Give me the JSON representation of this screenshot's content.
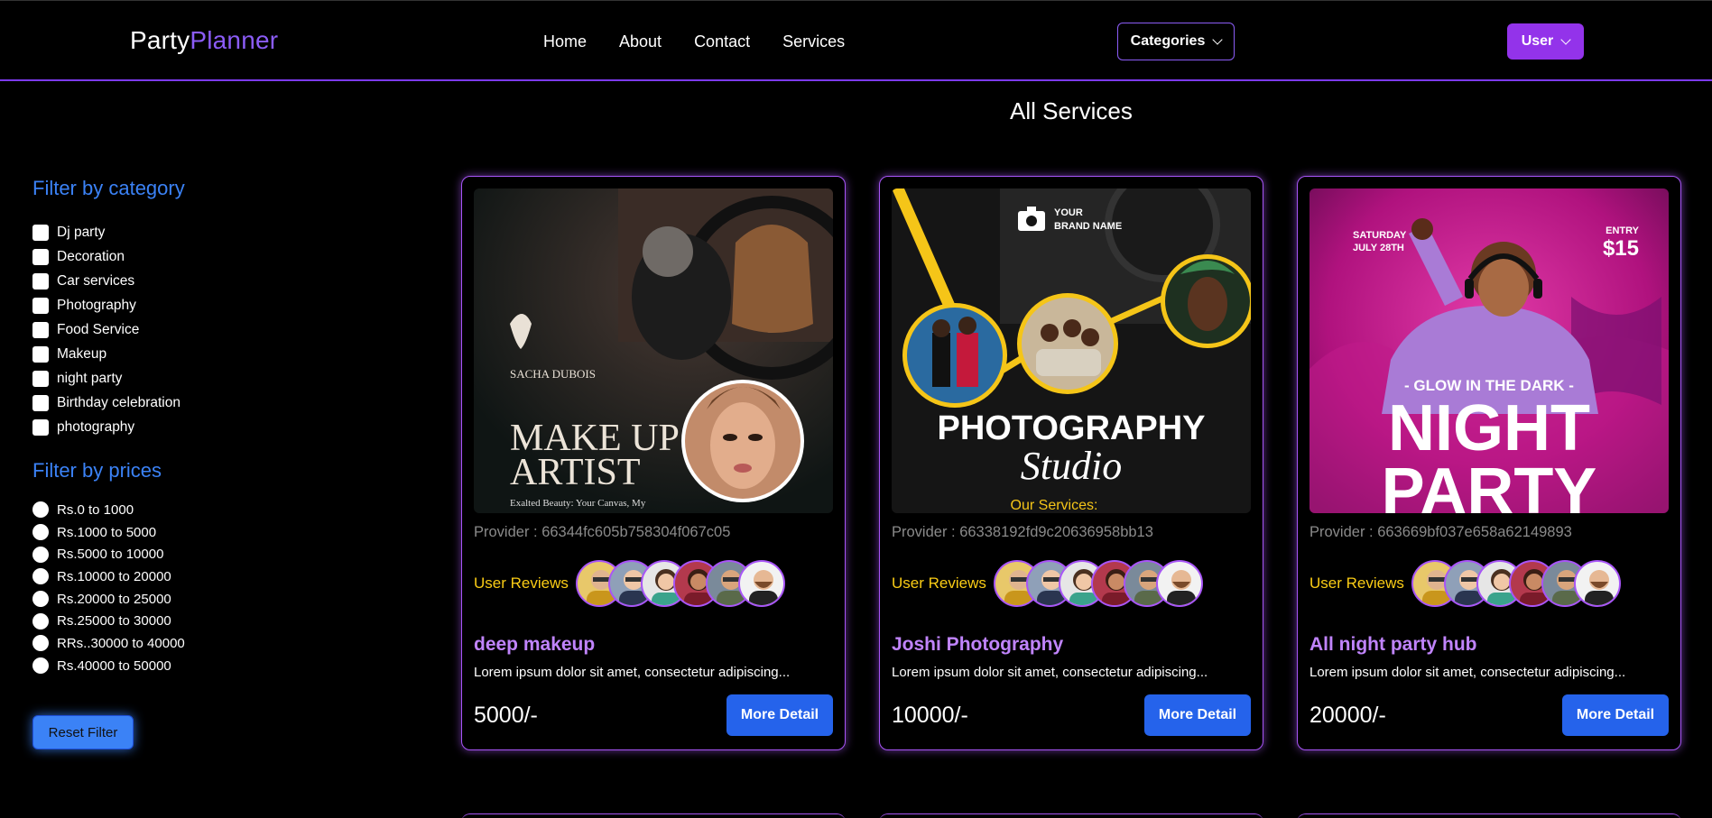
{
  "brand": {
    "part1": "Party",
    "part2": "Planner"
  },
  "nav": {
    "links": [
      "Home",
      "About",
      "Contact",
      "Services"
    ],
    "categories_label": "Categories",
    "user_label": "User"
  },
  "page_title": "All Services",
  "sidebar": {
    "category_heading": "Filter by category",
    "categories": [
      "Dj party",
      "Decoration",
      "Car services",
      "Photography",
      "Food Service",
      "Makeup",
      "night party",
      "Birthday celebration",
      "photography"
    ],
    "price_heading": "Filter by prices",
    "prices": [
      "Rs.0 to 1000",
      "Rs.1000 to 5000",
      "Rs.5000 to 10000",
      "Rs.10000 to 20000",
      "Rs.20000 to 25000",
      "Rs.25000 to 30000",
      "RRs..30000 to 40000",
      "Rs.40000 to 50000"
    ],
    "reset_label": "Reset Filter"
  },
  "cards": [
    {
      "provider": "Provider : 66344fc605b758304f067c05",
      "reviews_label": "User Reviews",
      "title": "deep makeup",
      "description": "Lorem ipsum dolor sit amet, consectetur adipiscing...",
      "price": "5000/-",
      "button": "More Detail",
      "poster": {
        "logo": "SACHA DUBOIS",
        "line1": "MAKE UP",
        "line2": "ARTIST",
        "tagline": "Exalted Beauty: Your Canvas, My"
      }
    },
    {
      "provider": "Provider : 66338192fd9c20636958bb13",
      "reviews_label": "User Reviews",
      "title": "Joshi Photography",
      "description": "Lorem ipsum dolor sit amet, consectetur adipiscing...",
      "price": "10000/-",
      "button": "More Detail",
      "poster": {
        "brand1": "YOUR",
        "brand2": "BRAND NAME",
        "line1": "PHOTOGRAPHY",
        "line2": "Studio",
        "line3": "Our Services:"
      }
    },
    {
      "provider": "Provider : 663669bf037e658a62149893",
      "reviews_label": "User Reviews",
      "title": "All night party hub",
      "description": "Lorem ipsum dolor sit amet, consectetur adipiscing...",
      "price": "20000/-",
      "button": "More Detail",
      "poster": {
        "date1": "SATURDAY",
        "date2": "JULY 28TH",
        "entry1": "ENTRY",
        "entry2": "$15",
        "glow": "- GLOW IN THE DARK -",
        "line1": "NIGHT",
        "line2": "PARTY"
      }
    }
  ],
  "colors": {
    "accent": "#8b5cf6",
    "card_border": "#a855f7",
    "filter_heading": "#3b82f6",
    "button": "#2563eb",
    "reviews": "#facc15",
    "title": "#c084fc"
  }
}
